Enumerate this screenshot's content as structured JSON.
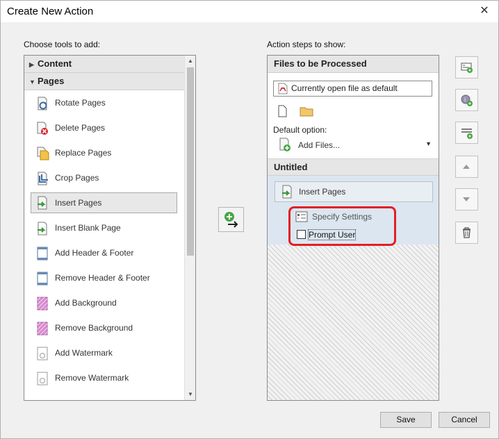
{
  "window": {
    "title": "Create New Action",
    "close_glyph": "✕"
  },
  "left": {
    "label": "Choose tools to add:",
    "sections": [
      {
        "label": "Content",
        "expanded": false
      },
      {
        "label": "Pages",
        "expanded": true
      }
    ],
    "tools": [
      {
        "label": "Rotate Pages",
        "icon": "rotate-pages-icon"
      },
      {
        "label": "Delete Pages",
        "icon": "delete-pages-icon"
      },
      {
        "label": "Replace Pages",
        "icon": "replace-pages-icon"
      },
      {
        "label": "Crop Pages",
        "icon": "crop-pages-icon"
      },
      {
        "label": "Insert Pages",
        "icon": "insert-pages-icon",
        "selected": true
      },
      {
        "label": "Insert Blank Page",
        "icon": "insert-blank-page-icon"
      },
      {
        "label": "Add Header & Footer",
        "icon": "add-header-footer-icon"
      },
      {
        "label": "Remove Header & Footer",
        "icon": "remove-header-footer-icon"
      },
      {
        "label": "Add Background",
        "icon": "add-background-icon"
      },
      {
        "label": "Remove Background",
        "icon": "remove-background-icon"
      },
      {
        "label": "Add Watermark",
        "icon": "add-watermark-icon"
      },
      {
        "label": "Remove Watermark",
        "icon": "remove-watermark-icon"
      }
    ]
  },
  "right": {
    "label": "Action steps to show:",
    "files_header": "Files to be Processed",
    "file_value": "Currently open file as default",
    "default_option_label": "Default option:",
    "default_option_value": "Add Files...",
    "group_header": "Untitled",
    "step_label": "Insert Pages",
    "specify_settings": "Specify Settings",
    "prompt_user": "Prompt User",
    "prompt_user_checked": false
  },
  "side_buttons": [
    "add-instruction-step-icon",
    "add-panel-separator-icon",
    "add-panel-icon",
    "move-up-icon",
    "move-down-icon",
    "delete-icon"
  ],
  "buttons": {
    "save": "Save",
    "cancel": "Cancel"
  },
  "colors": {
    "highlight_box": "#e31e24",
    "step_section_bg": "#dbe6f0"
  }
}
